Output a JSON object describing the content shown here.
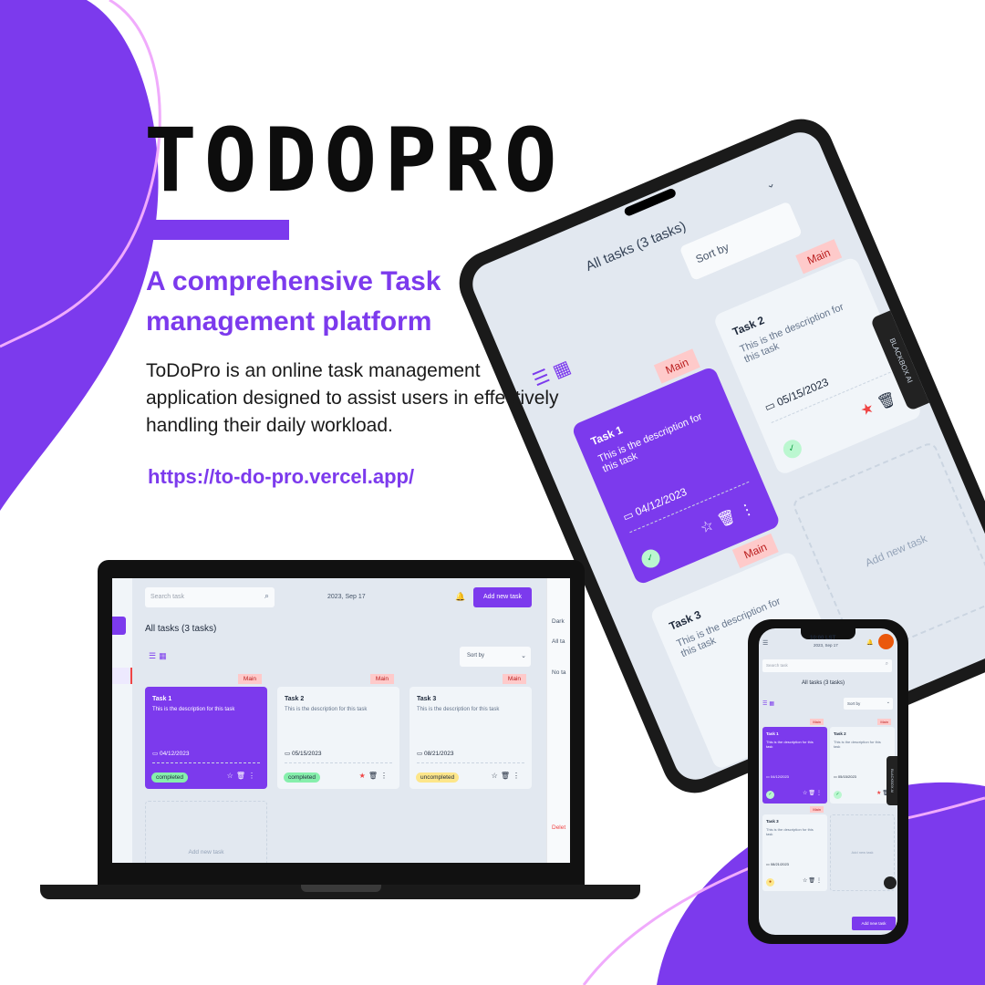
{
  "hero": {
    "brand": "TODOPRO",
    "headline": "A comprehensive Task management platform",
    "description": "ToDoPro is an online task management application designed to assist users in effectively handling their daily workload.",
    "url": "https://to-do-pro.vercel.app/"
  },
  "colors": {
    "accent": "#7c3aed",
    "tag_bg": "#fecaca",
    "completed_badge": "#86efac",
    "uncompleted_badge": "#fde68a",
    "star_active": "#ef4444"
  },
  "icons": {
    "search": "search-icon",
    "bell": "bell-icon",
    "list_view": "list-view-icon",
    "grid_view": "grid-view-icon",
    "calendar": "calendar-icon",
    "star": "star-icon",
    "trash": "trash-icon",
    "more": "more-vertical-icon",
    "check": "check-icon",
    "chevron": "chevron-down-icon",
    "menu": "menu-icon"
  },
  "laptop": {
    "search_placeholder": "Search task",
    "date": "2023, Sep 17",
    "add_button": "Add new task",
    "title": "All tasks (3 tasks)",
    "sort_label": "Sort by",
    "right_panel": [
      "Dark",
      "All ta",
      "No ta",
      "Delet"
    ],
    "add_new_task": "Add new task",
    "tasks": [
      {
        "title": "Task 1",
        "desc": "This is the description for this task",
        "tag": "Main",
        "date": "04/12/2023",
        "status": "completed",
        "starred": false
      },
      {
        "title": "Task 2",
        "desc": "This is the description for this task",
        "tag": "Main",
        "date": "05/15/2023",
        "status": "completed",
        "starred": true
      },
      {
        "title": "Task 3",
        "desc": "This is the description for this task",
        "tag": "Main",
        "date": "08/21/2023",
        "status": "uncompleted",
        "starred": false
      }
    ]
  },
  "tablet": {
    "title": "All tasks (3 tasks)",
    "sort_label": "Sort by",
    "add_new_task": "Add new task",
    "blackbox": "BLACKBOX AI",
    "tasks": [
      {
        "title": "Task 1",
        "desc": "This is the description for this task",
        "tag": "Main",
        "date": "04/12/2023"
      },
      {
        "title": "Task 2",
        "desc": "This is the description for this task",
        "tag": "Main",
        "date": "05/15/2023"
      },
      {
        "title": "Task 3",
        "desc": "This is the description for this task",
        "tag": "Main"
      }
    ]
  },
  "phone": {
    "time": "10:00 LST",
    "date": "2023, Sep 17",
    "search_placeholder": "Search task",
    "title": "All tasks (3 tasks)",
    "sort_label": "Sort by",
    "add_new_task": "Add new task",
    "add_button": "Add new task",
    "blackbox": "BLACKBOX AI",
    "tasks": [
      {
        "title": "Task 1",
        "desc": "This is the description for this task",
        "tag": "Main",
        "date": "04/12/2023"
      },
      {
        "title": "Task 2",
        "desc": "This is the description for this task",
        "tag": "Main",
        "date": "05/15/2023"
      },
      {
        "title": "Task 3",
        "desc": "This is the description for this task",
        "tag": "Main",
        "date": "08/21/2023"
      }
    ]
  }
}
